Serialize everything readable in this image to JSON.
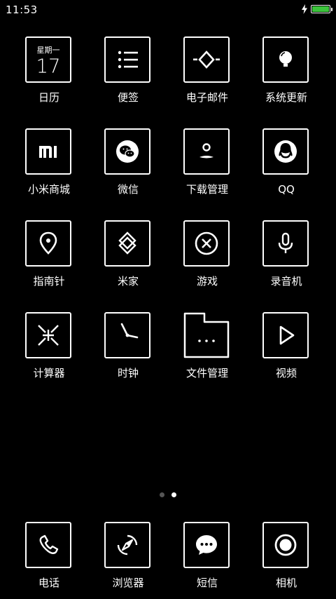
{
  "status_bar": {
    "time": "11:53",
    "battery_level": 1.0,
    "charging": true,
    "battery_color": "#3cc33c"
  },
  "apps": [
    [
      {
        "label": "日历",
        "icon": "calendar-icon",
        "weekday": "星期一",
        "day": "17"
      },
      {
        "label": "便签",
        "icon": "notes-list-icon"
      },
      {
        "label": "电子邮件",
        "icon": "email-icon"
      },
      {
        "label": "系统更新",
        "icon": "lightbulb-update-icon"
      }
    ],
    [
      {
        "label": "小米商城",
        "icon": "mi-logo-icon"
      },
      {
        "label": "微信",
        "icon": "wechat-icon"
      },
      {
        "label": "下载管理",
        "icon": "download-manager-icon"
      },
      {
        "label": "QQ",
        "icon": "qq-penguin-icon"
      }
    ],
    [
      {
        "label": "指南针",
        "icon": "compass-pin-icon"
      },
      {
        "label": "米家",
        "icon": "mijia-icon"
      },
      {
        "label": "游戏",
        "icon": "game-close-circle-icon"
      },
      {
        "label": "录音机",
        "icon": "microphone-icon"
      }
    ],
    [
      {
        "label": "计算器",
        "icon": "calculator-icon"
      },
      {
        "label": "时钟",
        "icon": "clock-icon"
      },
      {
        "label": "文件管理",
        "icon": "folder-icon"
      },
      {
        "label": "视频",
        "icon": "play-icon"
      }
    ]
  ],
  "page_indicator": {
    "pages": 2,
    "current": 2
  },
  "dock": [
    {
      "label": "电话",
      "icon": "phone-icon"
    },
    {
      "label": "浏览器",
      "icon": "browser-compass-icon"
    },
    {
      "label": "短信",
      "icon": "message-bubble-icon"
    },
    {
      "label": "相机",
      "icon": "camera-icon"
    }
  ]
}
